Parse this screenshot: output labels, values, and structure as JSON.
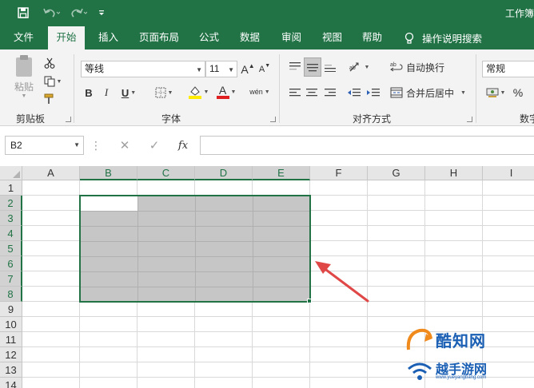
{
  "titlebar": {
    "title": "工作簿",
    "icons": [
      "save-icon",
      "undo-icon",
      "redo-icon",
      "customize-qat-icon"
    ]
  },
  "tabs": [
    {
      "label": "文件"
    },
    {
      "label": "开始"
    },
    {
      "label": "插入"
    },
    {
      "label": "页面布局"
    },
    {
      "label": "公式"
    },
    {
      "label": "数据"
    },
    {
      "label": "审阅"
    },
    {
      "label": "视图"
    },
    {
      "label": "帮助"
    }
  ],
  "tell_me": "操作说明搜索",
  "ribbon": {
    "clipboard": {
      "paste_label": "粘贴",
      "group_label": "剪贴板"
    },
    "font": {
      "font_name": "等线",
      "font_size": "11",
      "bold": "B",
      "italic": "I",
      "underline": "U",
      "font_color_glyph": "A",
      "grow_glyph": "A",
      "shrink_glyph": "A",
      "phonetic_glyph": "wén",
      "group_label": "字体"
    },
    "alignment": {
      "wrap_text": "自动换行",
      "merge_center": "合并后居中",
      "group_label": "对齐方式"
    },
    "number": {
      "format": "常规",
      "percent": "%",
      "group_label": "数字"
    }
  },
  "formula_bar": {
    "name_box": "B2",
    "cancel": "✕",
    "enter": "✓",
    "fx": "fx",
    "formula": ""
  },
  "sheet": {
    "columns": [
      "A",
      "B",
      "C",
      "D",
      "E",
      "F",
      "G",
      "H",
      "I"
    ],
    "rows": [
      "1",
      "2",
      "3",
      "4",
      "5",
      "6",
      "7",
      "8",
      "9",
      "10",
      "11",
      "12",
      "13",
      "14"
    ],
    "selected_range": "B2:E8",
    "active_cell": "B2"
  },
  "watermark": {
    "line1": "酷知网",
    "line2": "越手游网",
    "line3": "www.yueyangbang.com"
  },
  "colors": {
    "accent": "#217346",
    "selection": "#c6c6c6",
    "annotation": "#e04848"
  }
}
